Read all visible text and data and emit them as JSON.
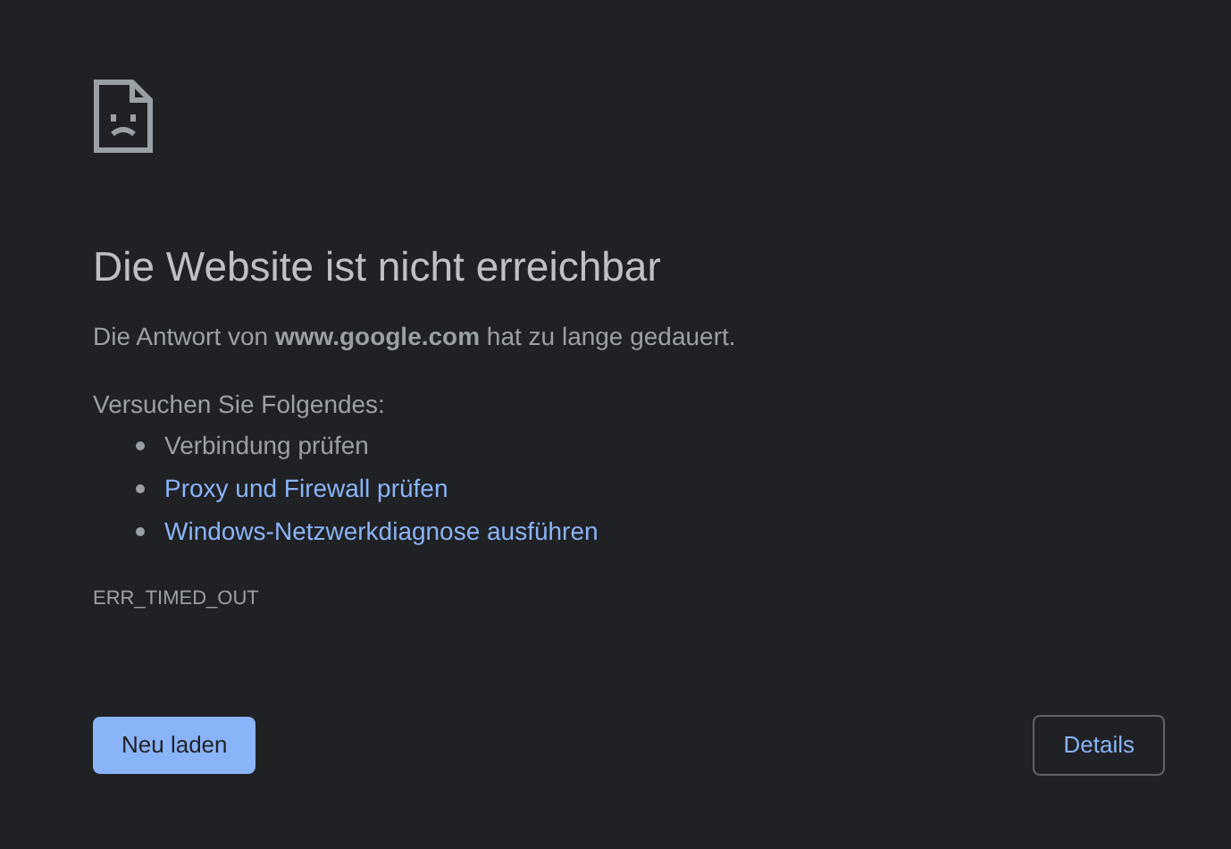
{
  "title": "Die Website ist nicht erreichbar",
  "message": "Die Antwort von **www.google.com** hat zu lange gedauert.",
  "suggestions_heading": "Versuchen Sie Folgendes:",
  "suggestions": [
    {
      "text": "Verbindung prüfen",
      "kind": "plain"
    },
    {
      "text": "Proxy und Firewall prüfen",
      "kind": "link"
    },
    {
      "text": "Windows-Netzwerkdiagnose ausführen",
      "kind": "link"
    }
  ],
  "error_code": "ERR_TIMED_OUT",
  "buttons": [
    {
      "label": "Neu laden",
      "kind": "primary"
    },
    {
      "label": "Details",
      "kind": "secondary"
    }
  ]
}
